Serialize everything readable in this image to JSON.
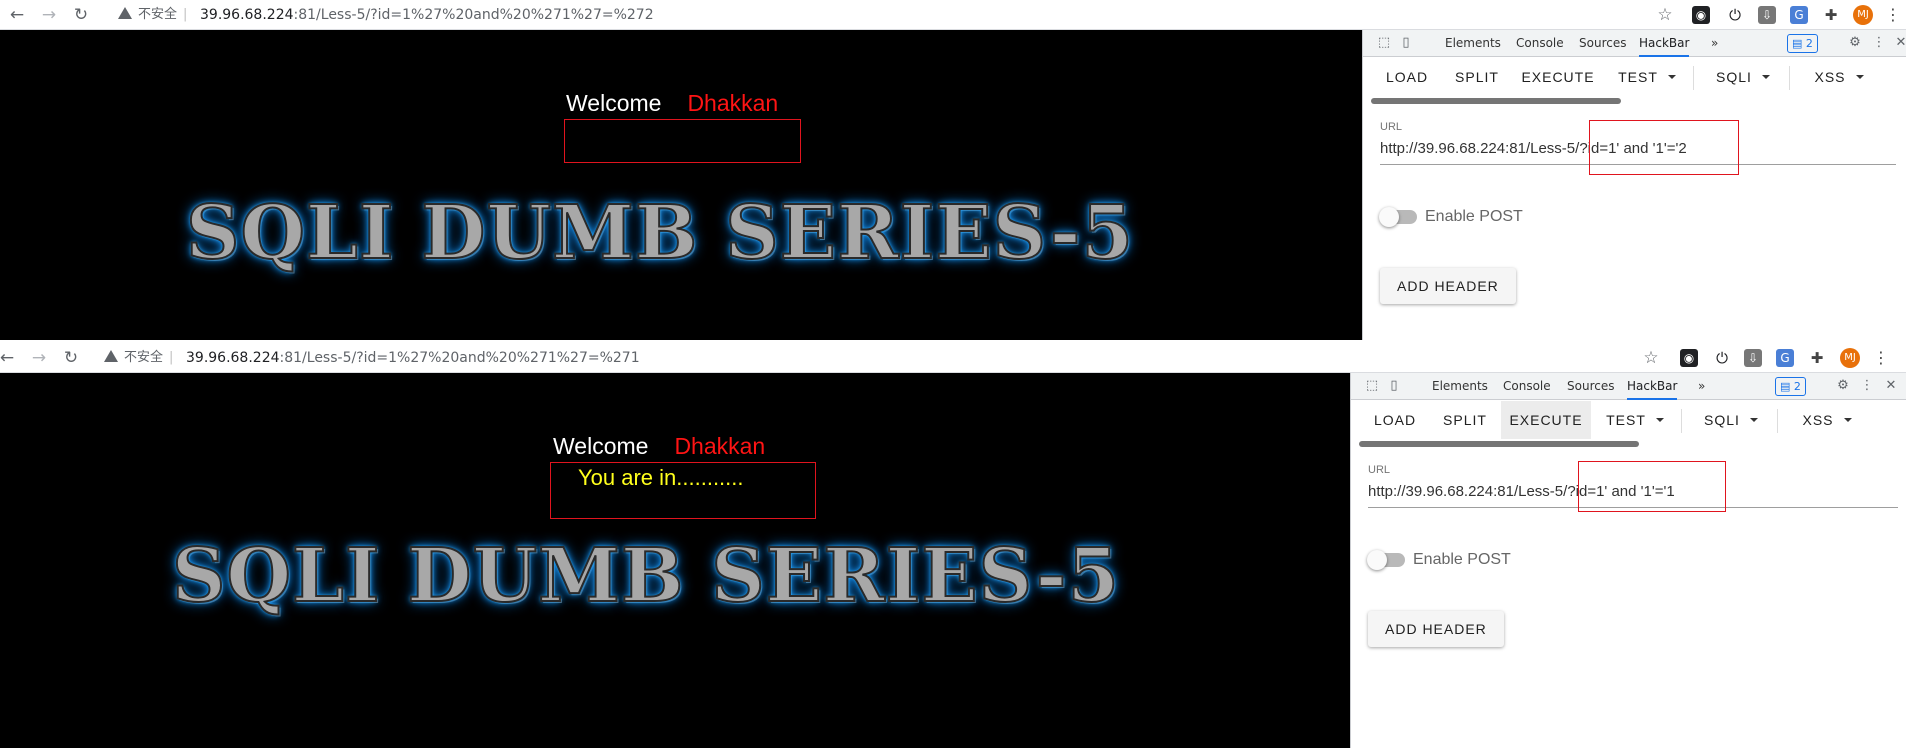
{
  "top": {
    "insecure_label": "不安全",
    "address": {
      "host": "39.96.68.224",
      "path": ":81/Less-5/?id=1%27%20and%20%271%27=%272"
    },
    "page": {
      "welcome": "Welcome",
      "user": "Dhakkan",
      "message": "",
      "banner": "SQLI DUMB SERIES-5"
    },
    "devtools": {
      "tabs": [
        "Elements",
        "Console",
        "Sources",
        "HackBar"
      ],
      "more": "»",
      "badge": "2",
      "hackbar_buttons": [
        "LOAD",
        "SPLIT",
        "EXECUTE",
        "TEST",
        "SQLI",
        "XSS"
      ],
      "url_label": "URL",
      "url_value": "http://39.96.68.224:81/Less-5/?id=1' and '1'='2",
      "enable_post": "Enable POST",
      "add_header": "ADD HEADER"
    }
  },
  "bottom": {
    "insecure_label": "不安全",
    "address": {
      "host": "39.96.68.224",
      "path": ":81/Less-5/?id=1%27%20and%20%271%27=%271"
    },
    "page": {
      "welcome": "Welcome",
      "user": "Dhakkan",
      "message": "You are in...........",
      "banner": "SQLI DUMB SERIES-5"
    },
    "devtools": {
      "tabs": [
        "Elements",
        "Console",
        "Sources",
        "HackBar"
      ],
      "more": "»",
      "badge": "2",
      "hackbar_buttons": [
        "LOAD",
        "SPLIT",
        "EXECUTE",
        "TEST",
        "SQLI",
        "XSS"
      ],
      "url_label": "URL",
      "url_value": "http://39.96.68.224:81/Less-5/?id=1' and '1'='1",
      "enable_post": "Enable POST",
      "add_header": "ADD HEADER"
    }
  },
  "icons": [
    "back-icon",
    "forward-icon",
    "reload-icon",
    "warning-icon",
    "bookmark-star-icon",
    "extension-icon",
    "power-icon",
    "download-icon",
    "translate-icon",
    "puzzle-icon",
    "avatar",
    "kebab-menu-icon",
    "inspect-icon",
    "device-toolbar-icon",
    "gear-icon",
    "close-icon"
  ],
  "avatar_initials": "MJ",
  "colors": {
    "welcome_user": "#ff1414",
    "message": "#ffff1c",
    "highlight": "#e0141e",
    "banner_glow": "#1f9fff",
    "devtools_accent": "#1a73e8"
  }
}
